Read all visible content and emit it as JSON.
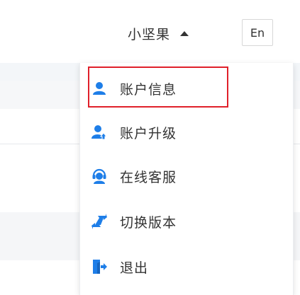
{
  "header": {
    "user_name": "小坚果",
    "language_label": "En"
  },
  "dropdown": {
    "items": [
      {
        "label": "账户信息",
        "icon": "user-icon"
      },
      {
        "label": "账户升级",
        "icon": "user-upgrade-icon"
      },
      {
        "label": "在线客服",
        "icon": "headset-icon"
      },
      {
        "label": "切换版本",
        "icon": "swap-icon"
      },
      {
        "label": "退出",
        "icon": "logout-icon"
      }
    ],
    "highlighted_index": 0
  },
  "colors": {
    "accent": "#1e7ee8",
    "highlight_border": "#e0202a",
    "text": "#333333"
  }
}
